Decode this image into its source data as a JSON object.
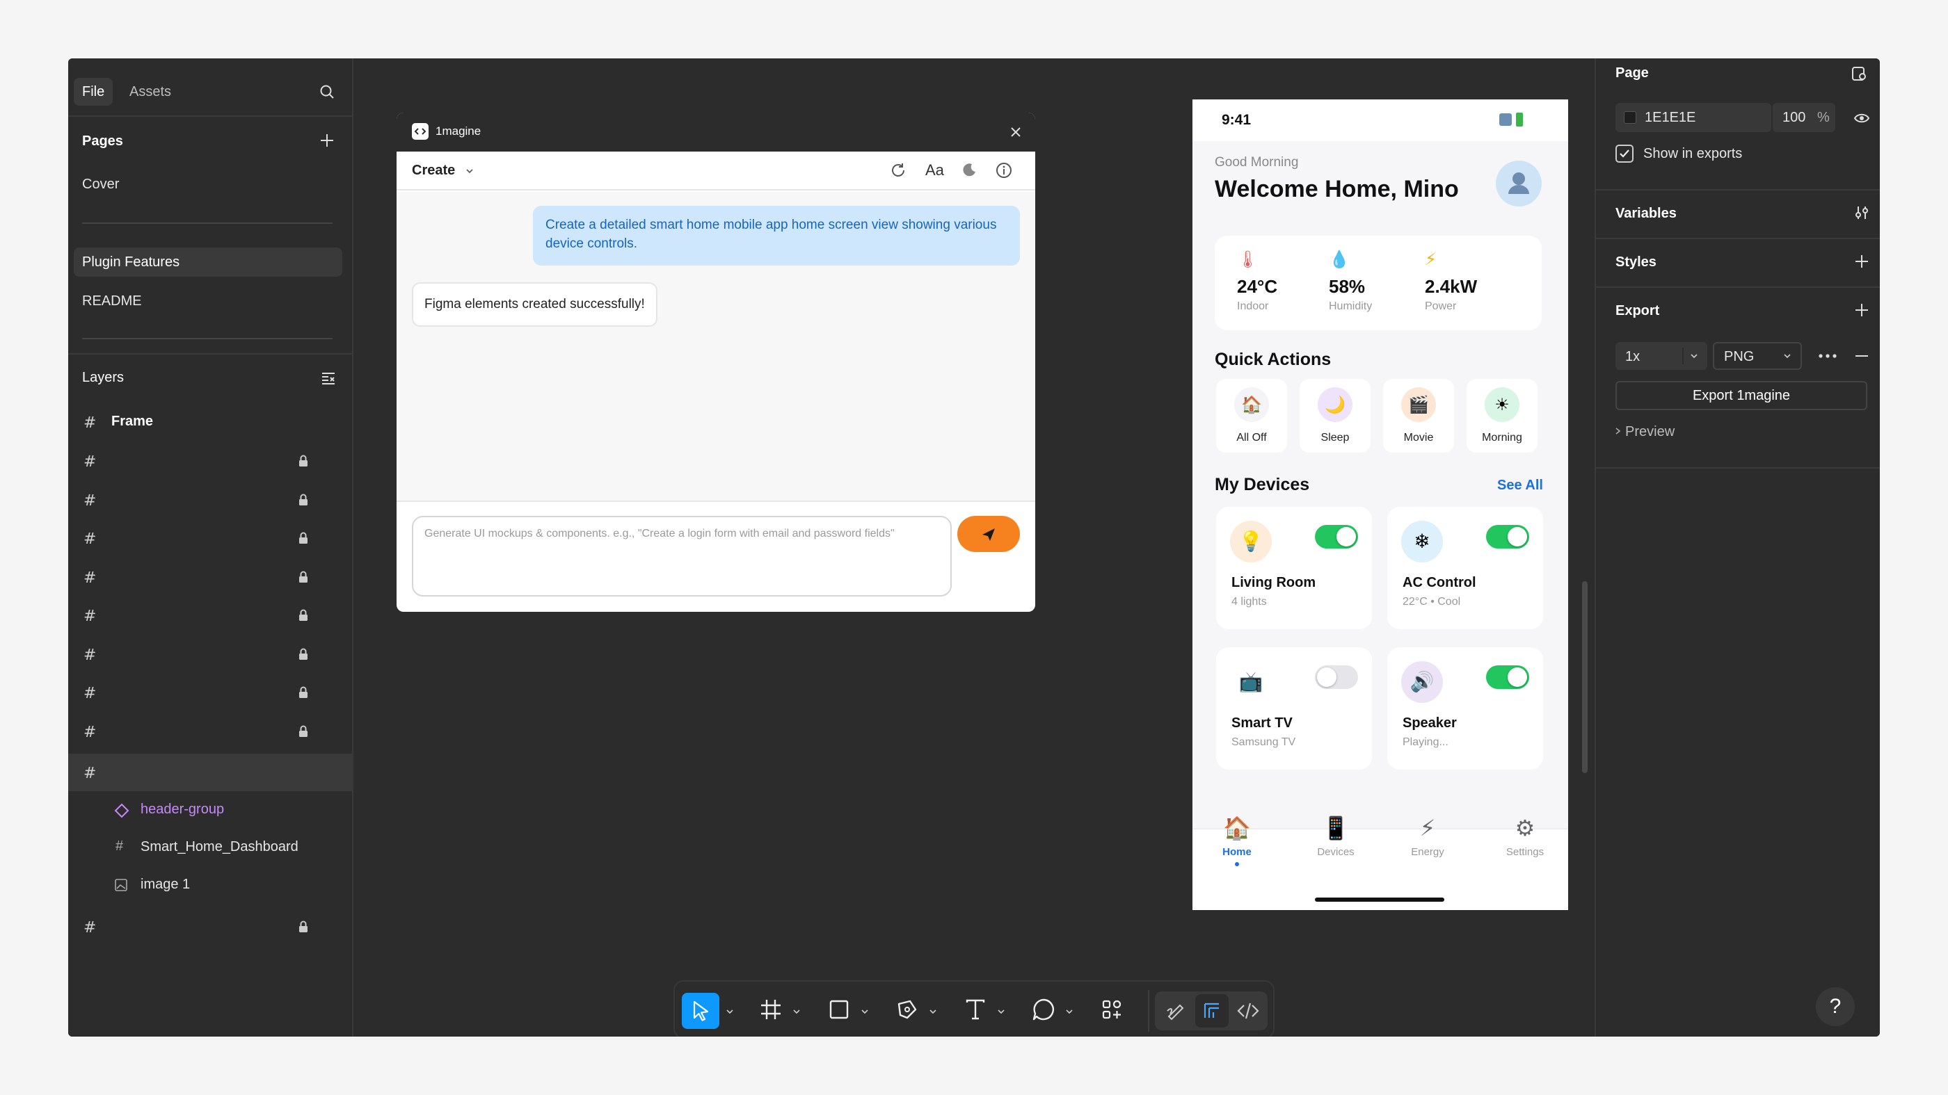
{
  "left_panel": {
    "tabs": {
      "file": "File",
      "assets": "Assets"
    },
    "pages_header": "Pages",
    "pages": [
      "Cover",
      "Plugin Features",
      "README"
    ],
    "layers_header": "Layers",
    "frame_label": "Frame",
    "sublayers": [
      "header-group",
      "Smart_Home_Dashboard",
      "image 1"
    ]
  },
  "plugin": {
    "window_title": "1magine",
    "mode_label": "Create",
    "font_button": "Aa",
    "user_message": "Create a detailed smart home mobile app home screen view showing various device controls.",
    "bot_message": "Figma elements created successfully!",
    "prompt_placeholder": "Generate UI mockups & components. e.g., \"Create a login form with email and password fields\""
  },
  "phone": {
    "time": "9:41",
    "greeting": "Good Morning",
    "title": "Welcome Home, Mino",
    "stats": [
      {
        "icon": "🌡",
        "value": "24°C",
        "label": "Indoor"
      },
      {
        "icon": "💧",
        "value": "58%",
        "label": "Humidity"
      },
      {
        "icon": "⚡",
        "value": "2.4kW",
        "label": "Power"
      }
    ],
    "quick_actions_title": "Quick Actions",
    "quick_actions": [
      {
        "icon": "🏠",
        "label": "All Off",
        "color": "#f4f4f6"
      },
      {
        "icon": "🌙",
        "label": "Sleep",
        "color": "#efe3fb"
      },
      {
        "icon": "🎬",
        "label": "Movie",
        "color": "#fde6d4"
      },
      {
        "icon": "☀",
        "label": "Morning",
        "color": "#d9f5e6"
      }
    ],
    "devices_title": "My Devices",
    "see_all": "See All",
    "devices": [
      {
        "icon": "💡",
        "name": "Living Room",
        "sub": "4 lights",
        "on": true,
        "color": "#fdecd9"
      },
      {
        "icon": "❄",
        "name": "AC Control",
        "sub": "22°C • Cool",
        "on": true,
        "color": "#dcf1fb"
      },
      {
        "icon": "📺",
        "name": "Smart TV",
        "sub": "Samsung TV",
        "on": false,
        "color": "#ffffff"
      },
      {
        "icon": "🔊",
        "name": "Speaker",
        "sub": "Playing...",
        "on": true,
        "color": "#ece3f7"
      }
    ],
    "nav": [
      {
        "icon": "🏠",
        "label": "Home",
        "active": true
      },
      {
        "icon": "📱",
        "label": "Devices",
        "active": false
      },
      {
        "icon": "⚡",
        "label": "Energy",
        "active": false
      },
      {
        "icon": "⚙",
        "label": "Settings",
        "active": false
      }
    ]
  },
  "right_panel": {
    "page_header": "Page",
    "bg_color_hex": "1E1E1E",
    "opacity": "100",
    "percent": "%",
    "show_in_exports": "Show in exports",
    "variables": "Variables",
    "styles": "Styles",
    "export": "Export",
    "scale": "1x",
    "format": "PNG",
    "export_button": "Export 1magine",
    "preview": "Preview"
  },
  "help": "?",
  "colors": {
    "accent_blue": "#0d99ff",
    "send_orange": "#f5821f",
    "toggle_green": "#22c55e",
    "canvas": "#2c2c2c",
    "phone_link_blue": "#1e6fe0"
  }
}
